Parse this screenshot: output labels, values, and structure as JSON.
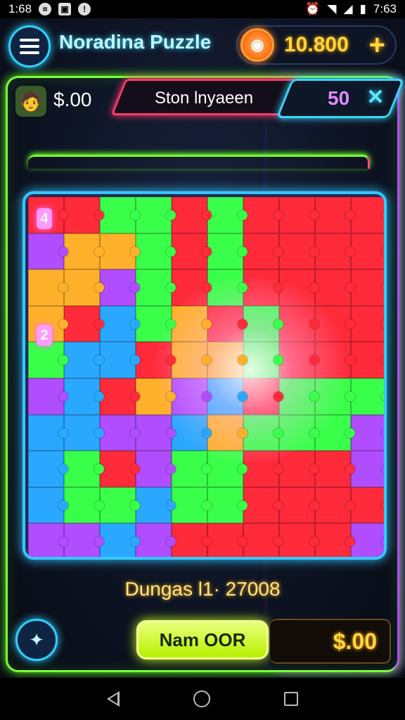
{
  "status_bar": {
    "time_left": "1:68",
    "time_right": "7:63",
    "left_icons": [
      "coin-notif-icon",
      "image-notif-icon",
      "info-notif-icon"
    ],
    "right_icons": [
      "alarm-icon",
      "wifi-icon",
      "signal-icon",
      "battery-icon"
    ]
  },
  "header": {
    "title": "Noradina Puzzle",
    "coins": "10.800",
    "plus_label": "+"
  },
  "info_bar": {
    "cash": "$.00",
    "level_name": "Ston lnyaeen",
    "score": "50",
    "shuffle_symbol": "✕"
  },
  "board": {
    "columns": 10,
    "rows": 10,
    "tile_colors": [
      [
        "#ff2a3a",
        "#ff2a3a",
        "#3aff4a",
        "#3aff4a",
        "#ff2a3a",
        "#3aff4a",
        "#ff2a3a",
        "#ff2a3a",
        "#ff2a3a",
        "#ff2a3a"
      ],
      [
        "#b04dff",
        "#ffb02a",
        "#ffb02a",
        "#3aff4a",
        "#ff2a3a",
        "#3aff4a",
        "#ff2a3a",
        "#ff2a3a",
        "#ff2a3a",
        "#ff2a3a"
      ],
      [
        "#ffb02a",
        "#ffb02a",
        "#b04dff",
        "#3aff4a",
        "#ff2a3a",
        "#3aff4a",
        "#ff2a3a",
        "#ff2a3a",
        "#ff2a3a",
        "#ff2a3a"
      ],
      [
        "#ffb02a",
        "#ff2a3a",
        "#2aa8ff",
        "#3aff4a",
        "#ffb02a",
        "#ff2a3a",
        "#3aff4a",
        "#ff2a3a",
        "#ff2a3a",
        "#ff2a3a"
      ],
      [
        "#3aff4a",
        "#2aa8ff",
        "#2aa8ff",
        "#ff2a3a",
        "#ffb02a",
        "#ffb02a",
        "#3aff4a",
        "#ff2a3a",
        "#ff2a3a",
        "#ff2a3a"
      ],
      [
        "#b04dff",
        "#2aa8ff",
        "#ff2a3a",
        "#ffb02a",
        "#b04dff",
        "#2aa8ff",
        "#ff2a3a",
        "#3aff4a",
        "#3aff4a",
        "#3aff4a"
      ],
      [
        "#2aa8ff",
        "#2aa8ff",
        "#b04dff",
        "#b04dff",
        "#2aa8ff",
        "#ffb02a",
        "#3aff4a",
        "#3aff4a",
        "#3aff4a",
        "#b04dff"
      ],
      [
        "#2aa8ff",
        "#3aff4a",
        "#ff2a3a",
        "#b04dff",
        "#3aff4a",
        "#3aff4a",
        "#ff2a3a",
        "#ff2a3a",
        "#ff2a3a",
        "#b04dff"
      ],
      [
        "#2aa8ff",
        "#3aff4a",
        "#3aff4a",
        "#2aa8ff",
        "#3aff4a",
        "#3aff4a",
        "#ff2a3a",
        "#ff2a3a",
        "#ff2a3a",
        "#ff2a3a"
      ],
      [
        "#b04dff",
        "#b04dff",
        "#2aa8ff",
        "#b04dff",
        "#ff2a3a",
        "#ff2a3a",
        "#ff2a3a",
        "#ff2a3a",
        "#ff2a3a",
        "#b04dff"
      ]
    ],
    "markers": [
      {
        "label": "4"
      },
      {
        "label": "2"
      }
    ]
  },
  "footer": {
    "level_info": "Dungas l1· 27008",
    "action_button": "Nam OOR",
    "cash": "$.00"
  }
}
